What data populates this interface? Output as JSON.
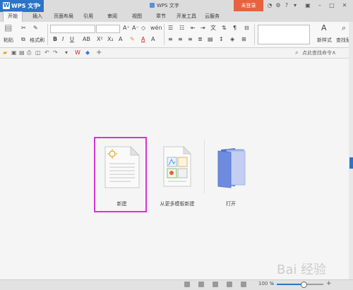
{
  "app": {
    "name": "WPS 文字",
    "logo_letter": "W"
  },
  "window": {
    "doc_title": "WPS 文字",
    "login_label": "未登录"
  },
  "menu": {
    "tabs": [
      "开始",
      "插入",
      "页面布局",
      "引用",
      "审阅",
      "视图",
      "章节",
      "开发工具",
      "云服务"
    ]
  },
  "ribbon": {
    "paste_label": "粘贴",
    "format_painter_label": "格式刷",
    "style_label": "新样式",
    "find_label": "查找替换"
  },
  "quickbar": {
    "search_label": "点此查找命令"
  },
  "main": {
    "actions": [
      {
        "label": "新建"
      },
      {
        "label": "从更多模板新建"
      },
      {
        "label": "打开"
      }
    ]
  },
  "statusbar": {
    "zoom": "100 %",
    "zoom_fraction": 0.58
  },
  "watermark": "Bai 经验",
  "colors": {
    "accent": "#2b74c7",
    "login": "#e8623f",
    "highlight_box": "#d634d6"
  }
}
